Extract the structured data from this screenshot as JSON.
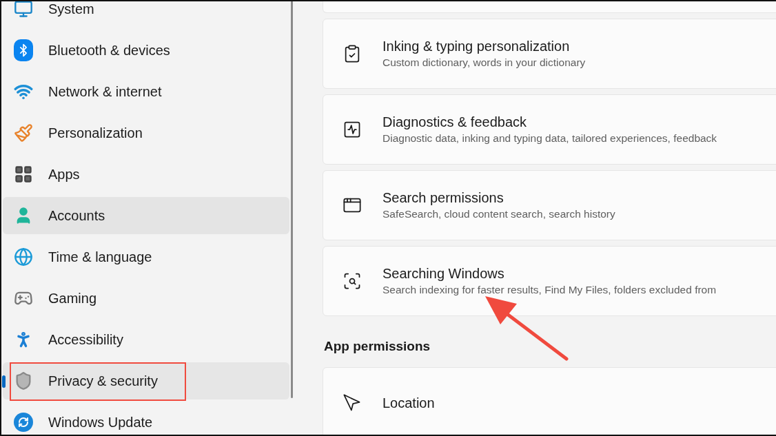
{
  "sidebar": {
    "items": [
      {
        "label": "System",
        "selected": false,
        "hovered": false,
        "highlighted": false
      },
      {
        "label": "Bluetooth & devices",
        "selected": false,
        "hovered": false,
        "highlighted": false
      },
      {
        "label": "Network & internet",
        "selected": false,
        "hovered": false,
        "highlighted": false
      },
      {
        "label": "Personalization",
        "selected": false,
        "hovered": false,
        "highlighted": false
      },
      {
        "label": "Apps",
        "selected": false,
        "hovered": false,
        "highlighted": false
      },
      {
        "label": "Accounts",
        "selected": false,
        "hovered": true,
        "highlighted": false
      },
      {
        "label": "Time & language",
        "selected": false,
        "hovered": false,
        "highlighted": false
      },
      {
        "label": "Gaming",
        "selected": false,
        "hovered": false,
        "highlighted": false
      },
      {
        "label": "Accessibility",
        "selected": false,
        "hovered": false,
        "highlighted": false
      },
      {
        "label": "Privacy & security",
        "selected": true,
        "hovered": false,
        "highlighted": true
      },
      {
        "label": "Windows Update",
        "selected": false,
        "hovered": false,
        "highlighted": false
      }
    ]
  },
  "settings": {
    "cards": [
      {
        "title": "Inking & typing personalization",
        "subtitle": "Custom dictionary, words in your dictionary"
      },
      {
        "title": "Diagnostics & feedback",
        "subtitle": "Diagnostic data, inking and typing data, tailored experiences, feedback"
      },
      {
        "title": "Search permissions",
        "subtitle": "SafeSearch, cloud content search, search history"
      },
      {
        "title": "Searching Windows",
        "subtitle": "Search indexing for faster results, Find My Files, folders excluded from"
      }
    ],
    "section_heading": "App permissions",
    "app_cards": [
      {
        "title": "Location"
      }
    ]
  }
}
